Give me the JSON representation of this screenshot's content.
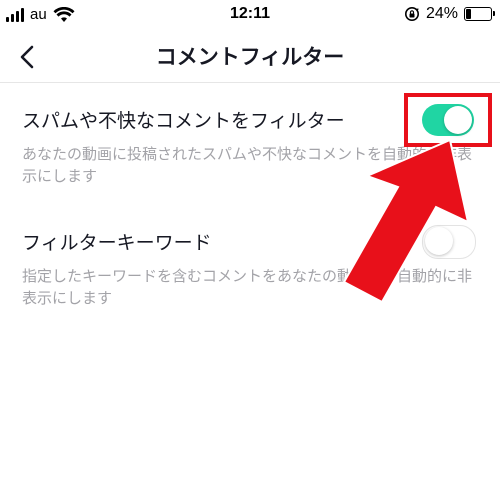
{
  "status_bar": {
    "carrier": "au",
    "time": "12:11",
    "battery_percent": "24%",
    "battery_level": 0.24,
    "icons": [
      "signal-icon",
      "wifi-icon",
      "rotation-lock-icon",
      "battery-icon"
    ]
  },
  "nav": {
    "title": "コメントフィルター",
    "back_icon": "chevron-left-icon"
  },
  "settings": [
    {
      "title": "スパムや不快なコメントをフィルター",
      "description": "あなたの動画に投稿されたスパムや不快なコメントを自動的に非表示にします",
      "enabled": true
    },
    {
      "title": "フィルターキーワード",
      "description": "指定したキーワードを含むコメントをあなたの動画から自動的に非表示にします",
      "enabled": false
    }
  ],
  "colors": {
    "toggle_on": "#20d5a3",
    "annotation_red": "#e8101a",
    "text_secondary": "#a3a3a8"
  }
}
